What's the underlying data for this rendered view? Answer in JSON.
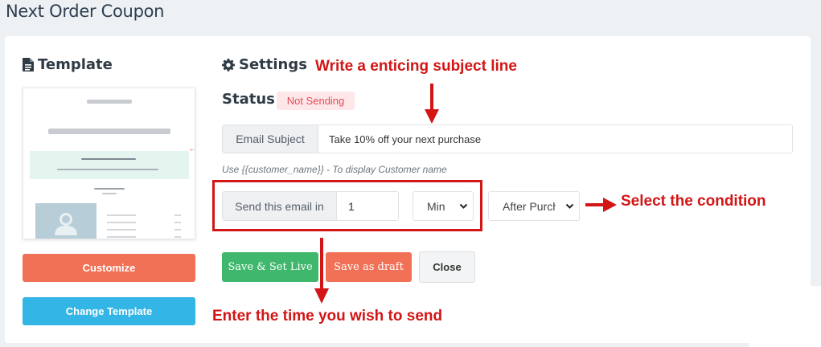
{
  "page": {
    "title": "Next Order Coupon"
  },
  "template": {
    "heading": "Template",
    "customize_label": "Customize",
    "change_label": "Change Template"
  },
  "settings": {
    "heading": "Settings",
    "status_label": "Status :",
    "status_value": "Not Sending",
    "subject_label": "Email Subject",
    "subject_value": "Take 10% off your next purchase",
    "hint": "Use {{customer_name}} - To display Customer name",
    "send_label": "Send this email in",
    "send_value": "1",
    "unit_selected": "Min",
    "condition_selected": "After Purchase",
    "save_live_label": "Save & Set Live",
    "save_draft_label": "Save as draft",
    "close_label": "Close"
  },
  "annotations": {
    "subject_note": "Write a enticing subject line",
    "condition_note": "Select the condition",
    "time_note": "Enter the time you wish to send"
  },
  "colors": {
    "accent_red": "#d21515",
    "customize_orange": "#f07156",
    "change_blue": "#33b5e5",
    "save_green": "#3fb76c",
    "status_red": "#e74c55"
  },
  "icons": [
    "file-icon",
    "gear-icon",
    "chevron-down-icon",
    "arrow-left-icon"
  ]
}
